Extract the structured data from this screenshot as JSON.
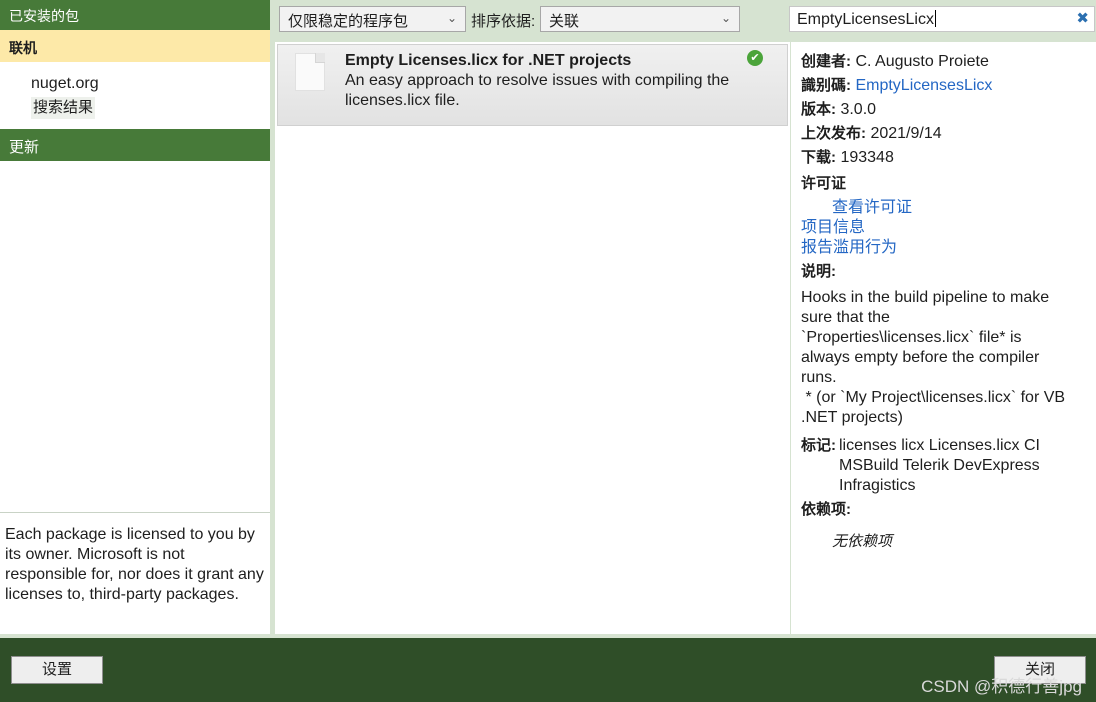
{
  "left": {
    "installed": "已安装的包",
    "online": "联机",
    "source": "nuget.org",
    "search_results": "搜索结果",
    "updates": "更新",
    "license_notice": "Each package is licensed to you by its owner. Microsoft is not responsible for, nor does it grant any licenses to, third-party packages."
  },
  "toolbar": {
    "filter": "仅限稳定的程序包",
    "sort_label": "排序依据:",
    "sort_value": "关联",
    "search_value": "EmptyLicensesLicx"
  },
  "package": {
    "title": "Empty Licenses.licx for .NET projects",
    "description": "An easy approach to resolve issues with compiling the licenses.licx file."
  },
  "details": {
    "creator_label": "创建者:",
    "creator": "C. Augusto Proiete",
    "id_label": "識别碼:",
    "id": "EmptyLicensesLicx",
    "version_label": "版本:",
    "version": "3.0.0",
    "published_label": "上次发布:",
    "published": "2021/9/14",
    "downloads_label": "下载:",
    "downloads": "193348",
    "license_label": "许可证",
    "view_license": "查看许可证",
    "project_info": "项目信息",
    "report_abuse": "报告滥用行为",
    "description_label": "说明:",
    "description": "Hooks in the build pipeline to make sure that the `Properties\\licenses.licx` file* is always empty before the compiler runs.\n * (or `My Project\\licenses.licx` for VB .NET projects)",
    "tags_label": "标记:",
    "tags": "licenses licx Licenses.licx CI MSBuild Telerik DevExpress Infragistics",
    "deps_label": "依赖项:",
    "no_deps": "无依赖项"
  },
  "footer": {
    "settings": "设置",
    "close": "关闭",
    "watermark": "CSDN @积德行善jpg"
  },
  "colors": {
    "accent_green": "#477a39",
    "footer_green": "#2f4e28",
    "selected_yellow": "#fde9a8",
    "link_blue": "#2467c4"
  }
}
